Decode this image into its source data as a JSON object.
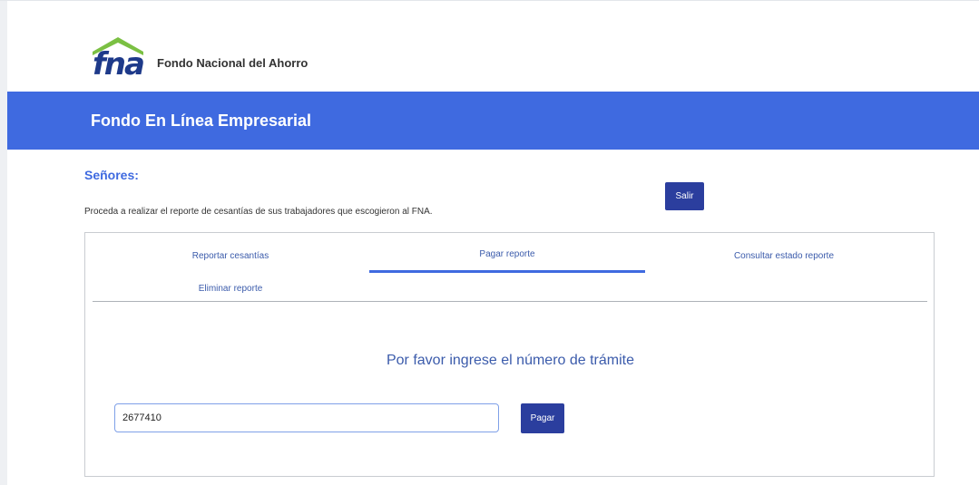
{
  "header": {
    "logo_text": "fna",
    "org_name": "Fondo Nacional del Ahorro"
  },
  "banner": {
    "title": "Fondo En Línea Empresarial"
  },
  "intro": {
    "greeting": "Señores:",
    "instructions": "Proceda a realizar el reporte de cesantías de sus trabajadores que escogieron al FNA.",
    "exit_label": "Salir"
  },
  "tabs": [
    {
      "label": "Reportar cesantías",
      "active": false
    },
    {
      "label": "Pagar reporte",
      "active": true
    },
    {
      "label": "Consultar estado reporte",
      "active": false
    },
    {
      "label": "Eliminar reporte",
      "active": false
    }
  ],
  "payment": {
    "prompt": "Por favor ingrese el número de trámite",
    "tramite_value": "2677410",
    "pay_label": "Pagar"
  },
  "colors": {
    "banner": "#3f6ae0",
    "button": "#2b3e9e",
    "logo_green": "#7bc043",
    "logo_blue": "#1e3a8a"
  }
}
